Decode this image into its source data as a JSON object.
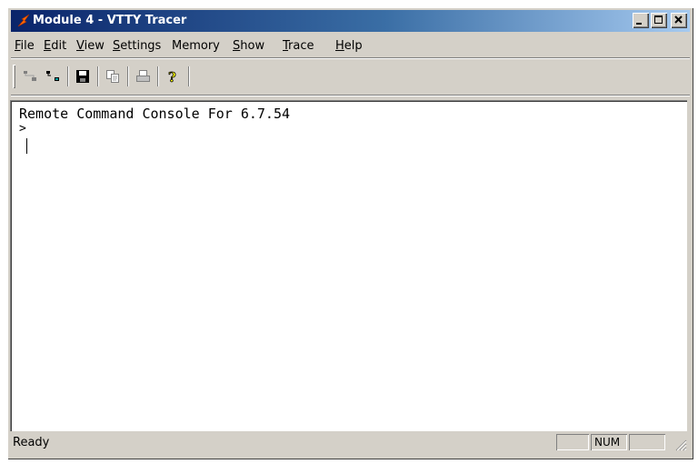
{
  "window": {
    "title": "Module 4 - VTTY Tracer",
    "icon": "tracer-app-icon",
    "controls": {
      "minimize": "minimize-icon",
      "maximize": "maximize-icon",
      "close": "close-icon"
    }
  },
  "menubar": {
    "items": [
      {
        "label": "File",
        "accel": "F",
        "rest": "ile"
      },
      {
        "label": "Edit",
        "accel": "E",
        "rest": "dit"
      },
      {
        "label": "View",
        "accel": "V",
        "rest": "iew"
      },
      {
        "label": "Settings",
        "accel": "S",
        "rest": "ettings"
      },
      {
        "label": "Memory",
        "accel": "",
        "rest": "Memory"
      },
      {
        "label": "Show",
        "accel": "S",
        "rest": "how"
      },
      {
        "label": "Trace",
        "accel": "T",
        "rest": "race"
      },
      {
        "label": "Help",
        "accel": "H",
        "rest": "elp"
      }
    ]
  },
  "toolbar": {
    "buttons": [
      "connect-icon",
      "disconnect-icon",
      "save-icon",
      "copy-icon",
      "print-icon",
      "help-icon"
    ]
  },
  "console": {
    "lines": [
      "Remote Command Console For 6.7.54",
      ">"
    ]
  },
  "statusbar": {
    "text": "Ready",
    "panels": [
      "",
      "NUM",
      ""
    ]
  },
  "colors": {
    "title_start": "#0a246a",
    "title_end": "#a6caf0",
    "face": "#d4d0c8"
  }
}
